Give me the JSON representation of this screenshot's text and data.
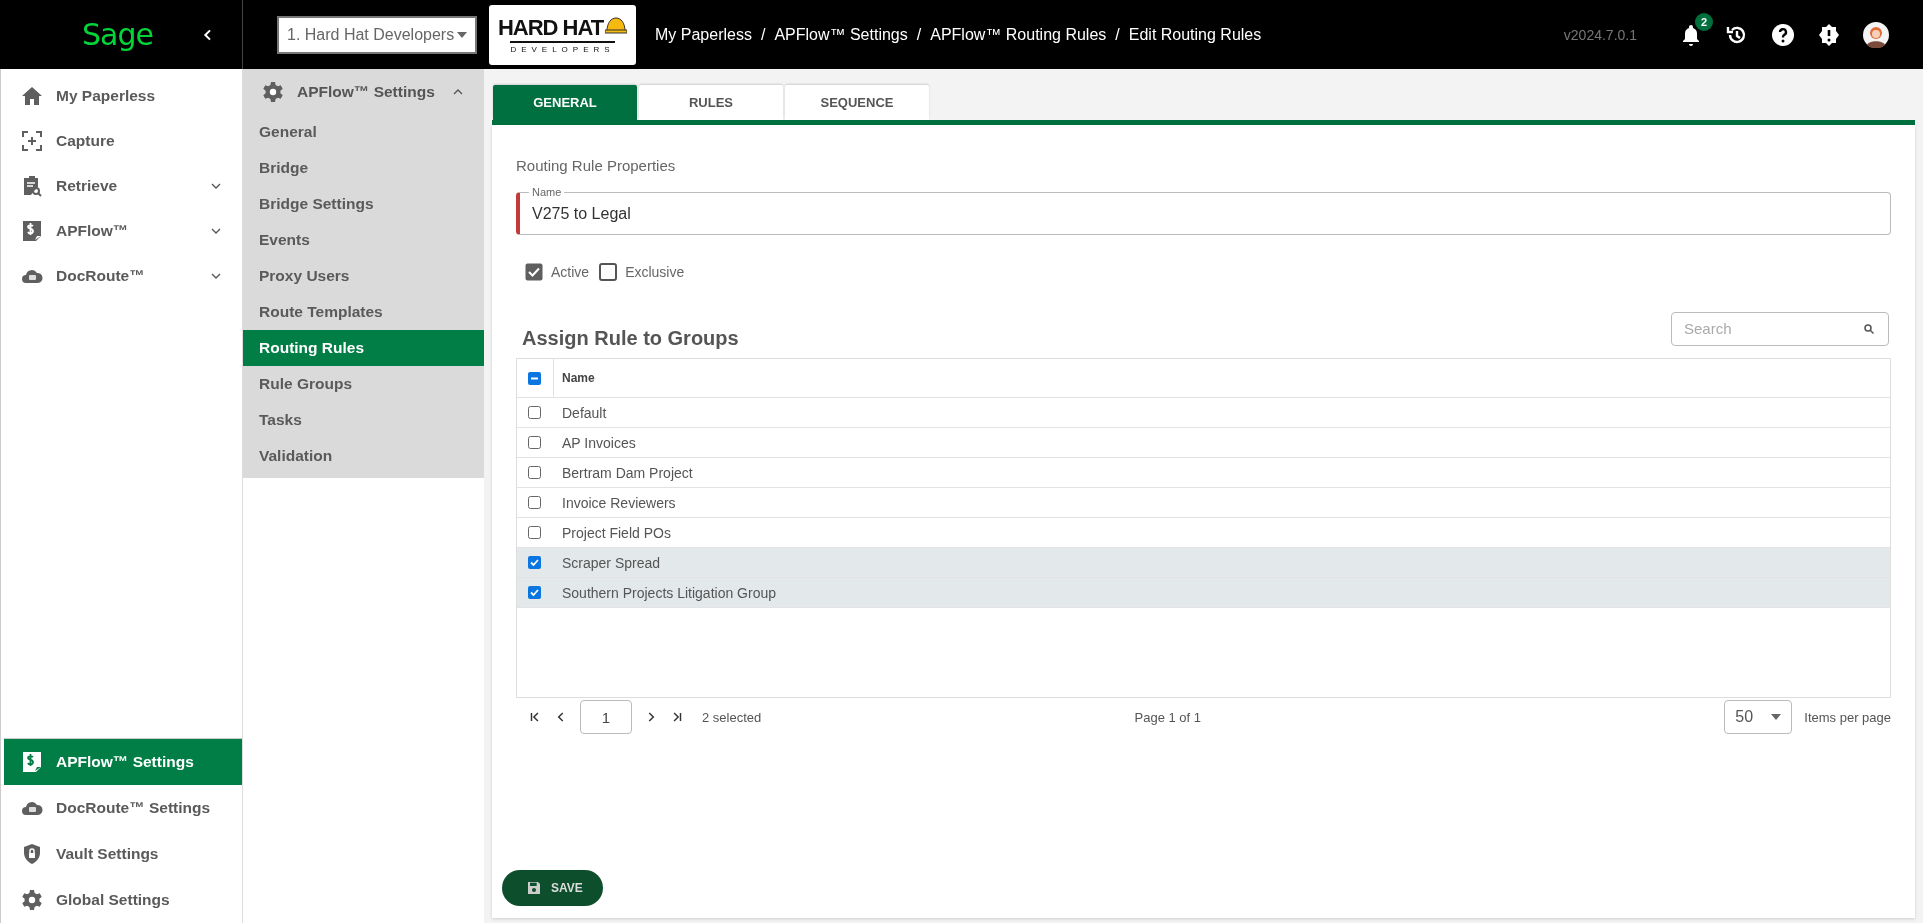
{
  "header": {
    "logo": "Sage",
    "company_select": "1. Hard Hat Developers",
    "company_logo": {
      "title": "HARD HAT",
      "subtitle": "DEVELOPERS"
    },
    "breadcrumbs": [
      {
        "label": "My Paperless"
      },
      {
        "separator": "/",
        "label": "APFlow™ Settings"
      },
      {
        "separator": "/",
        "label": "APFlow™ Routing Rules"
      },
      {
        "separator": "/",
        "label": "Edit Routing Rules"
      }
    ],
    "version": "v2024.7.0.1",
    "notification_count": "2"
  },
  "sidebar": {
    "items": [
      {
        "label": "My Paperless",
        "kind": "home",
        "expandable": false,
        "selected": false
      },
      {
        "label": "Capture",
        "kind": "capture",
        "expandable": false,
        "selected": false
      },
      {
        "label": "Retrieve",
        "kind": "retrieve",
        "expandable": true,
        "selected": false
      },
      {
        "label": "APFlow™",
        "kind": "dollar",
        "expandable": true,
        "selected": false
      },
      {
        "label": "DocRoute™",
        "kind": "cloud",
        "expandable": true,
        "selected": false
      }
    ],
    "bottom_items": [
      {
        "label": "APFlow™ Settings",
        "kind": "dollar",
        "selected": true
      },
      {
        "label": "DocRoute™ Settings",
        "kind": "cloud",
        "selected": false
      },
      {
        "label": "Vault Settings",
        "kind": "shield",
        "selected": false
      },
      {
        "label": "Global Settings",
        "kind": "gear",
        "selected": false
      }
    ]
  },
  "subnav": {
    "title": "APFlow™ Settings",
    "expanded": true,
    "items": [
      {
        "label": "General",
        "selected": false
      },
      {
        "label": "Bridge",
        "selected": false
      },
      {
        "label": "Bridge Settings",
        "selected": false
      },
      {
        "label": "Events",
        "selected": false
      },
      {
        "label": "Proxy Users",
        "selected": false
      },
      {
        "label": "Route Templates",
        "selected": false
      },
      {
        "label": "Routing Rules",
        "selected": true
      },
      {
        "label": "Rule Groups",
        "selected": false
      },
      {
        "label": "Tasks",
        "selected": false
      },
      {
        "label": "Validation",
        "selected": false
      }
    ]
  },
  "tabs": [
    {
      "label": "GENERAL",
      "selected": true
    },
    {
      "label": "RULES",
      "selected": false
    },
    {
      "label": "SEQUENCE",
      "selected": false
    }
  ],
  "form": {
    "section_title": "Routing Rule Properties",
    "name_field": {
      "label": "Name",
      "value": "V275 to Legal"
    },
    "checkboxes": [
      {
        "label": "Active",
        "checked": true
      },
      {
        "label": "Exclusive",
        "checked": false
      }
    ]
  },
  "groups": {
    "title": "Assign Rule to Groups",
    "search_placeholder": "Search",
    "header_indeterminate": true,
    "columns": [
      "Name"
    ],
    "rows": [
      {
        "name": "Default",
        "checked": false
      },
      {
        "name": "AP Invoices",
        "checked": false
      },
      {
        "name": "Bertram Dam Project",
        "checked": false
      },
      {
        "name": "Invoice Reviewers",
        "checked": false
      },
      {
        "name": "Project Field POs",
        "checked": false
      },
      {
        "name": "Scraper Spread",
        "checked": true
      },
      {
        "name": "Southern Projects Litigation Group",
        "checked": true
      }
    ]
  },
  "pager": {
    "page": "1",
    "selection": "2 selected",
    "page_info": "Page 1 of 1",
    "page_size": "50",
    "page_size_label": "Items per page"
  },
  "save_button": "SAVE"
}
